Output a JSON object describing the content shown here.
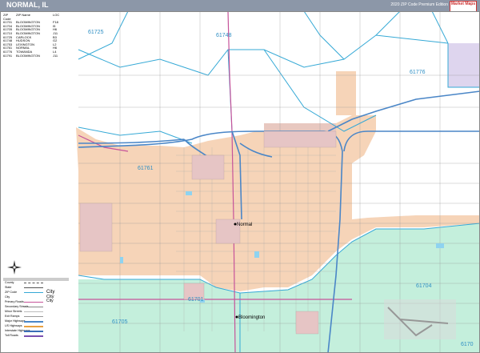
{
  "header": {
    "title": "NORMAL, IL",
    "edition": "2020 ZIP Code Premium Edition",
    "logo_text": "Market Maps",
    "bar_color": "#8c97a8"
  },
  "zip_table": {
    "columns": [
      "ZIP Code",
      "ZIP Name",
      "LOC"
    ],
    "rows": [
      [
        "61701",
        "BLOOMINGTON",
        "F18"
      ],
      [
        "61704",
        "BLOOMINGTON",
        "I5"
      ],
      [
        "61705",
        "BLOOMINGTON",
        "H6"
      ],
      [
        "61710",
        "BLOOMINGTON",
        "J11"
      ],
      [
        "61725",
        "CARLOCK",
        "B3"
      ],
      [
        "61748",
        "HUDSON",
        "G2"
      ],
      [
        "61753",
        "LEXINGTON",
        "L2"
      ],
      [
        "61761",
        "NORMAL",
        "H6"
      ],
      [
        "61776",
        "TOWANDA",
        "L4"
      ],
      [
        "61791",
        "BLOOMINGTON",
        "J11"
      ]
    ]
  },
  "map": {
    "zip_labels": [
      {
        "id": "61725",
        "text": "61725"
      },
      {
        "id": "61748",
        "text": "61748"
      },
      {
        "id": "61776",
        "text": "61776"
      },
      {
        "id": "61761",
        "text": "61761"
      },
      {
        "id": "61701",
        "text": "61701"
      },
      {
        "id": "61705",
        "text": "61705"
      },
      {
        "id": "61704",
        "text": "61704"
      },
      {
        "id": "61705b",
        "text": "6170"
      }
    ],
    "city_labels": [
      {
        "id": "normal",
        "text": "Normal"
      },
      {
        "id": "bloomington",
        "text": "Bloomington"
      }
    ],
    "colors": {
      "normal_zone": "#f6d4b8",
      "bloomington_zone": "#c4efdc",
      "towanda_zone": "#ded5ee",
      "zip_boundary": "#35a9d6",
      "highway": "#4a86c7",
      "primary_road": "#c6539a",
      "street": "#7a7a7a",
      "water": "#8fd3f0"
    }
  },
  "legend": {
    "header": "",
    "rows": [
      {
        "label": "County",
        "sample": "line"
      },
      {
        "label": "State",
        "sample": "line"
      },
      {
        "label": "ZIP Code",
        "sample": "zip"
      },
      {
        "label": "City",
        "sample": "city"
      },
      {
        "label": "Primary Roads",
        "sample": "road"
      },
      {
        "label": "Secondary Streets",
        "sample": "street"
      },
      {
        "label": "Minor Streets",
        "sample": "street"
      },
      {
        "label": "Exit Ramps",
        "sample": "road"
      },
      {
        "label": "Major Highways",
        "sample": "hwy"
      },
      {
        "label": "US Highways",
        "sample": "hwy"
      },
      {
        "label": "Interstate Highways",
        "sample": "hwy"
      },
      {
        "label": "Toll Roads",
        "sample": "road"
      }
    ],
    "city_samples": [
      "City",
      "City",
      "City"
    ]
  },
  "compass": {
    "label": "N"
  }
}
